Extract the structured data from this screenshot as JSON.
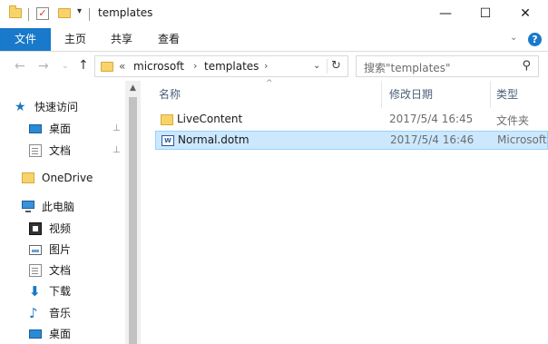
{
  "window": {
    "title": "templates",
    "quick_access_toolbar": {
      "dropdown_glyph": "▾",
      "check_glyph": "✓"
    },
    "controls": {
      "minimize": "—",
      "maximize": "☐",
      "close": "✕"
    }
  },
  "ribbon": {
    "tabs": [
      {
        "label": "文件",
        "active": true
      },
      {
        "label": "主页"
      },
      {
        "label": "共享"
      },
      {
        "label": "查看"
      }
    ],
    "expand_glyph": "⌄",
    "help_glyph": "?"
  },
  "navigation": {
    "back_glyph": "←",
    "forward_glyph": "→",
    "recent_glyph": "⌄",
    "up_glyph": "↑",
    "address": {
      "overflow": "«",
      "breadcrumbs": [
        "microsoft",
        "templates"
      ],
      "separator": "›",
      "dropdown_glyph": "⌄",
      "refresh_glyph": "↻"
    },
    "search": {
      "placeholder": "搜索\"templates\"",
      "icon": "search-icon",
      "icon_glyph": "⚲"
    }
  },
  "sidebar": {
    "scroll_up_glyph": "▲",
    "pin_glyph": "⊥",
    "items": [
      {
        "label": "快速访问",
        "icon": "star-icon",
        "glyph": "★"
      },
      {
        "label": "桌面",
        "icon": "desktop-icon",
        "pinned": true
      },
      {
        "label": "文档",
        "icon": "document-icon",
        "pinned": true
      },
      {
        "label": "OneDrive",
        "icon": "folder-icon"
      },
      {
        "label": "此电脑",
        "icon": "computer-icon"
      },
      {
        "label": "视频",
        "icon": "video-icon"
      },
      {
        "label": "图片",
        "icon": "pictures-icon"
      },
      {
        "label": "文档",
        "icon": "document-icon"
      },
      {
        "label": "下载",
        "icon": "download-icon",
        "glyph": "⬇"
      },
      {
        "label": "音乐",
        "icon": "music-icon",
        "glyph": "♪"
      },
      {
        "label": "桌面",
        "icon": "desktop-icon"
      }
    ]
  },
  "file_list": {
    "columns": [
      "名称",
      "修改日期",
      "类型"
    ],
    "sort_glyph": "^",
    "rows": [
      {
        "name": "LiveContent",
        "modified": "2017/5/4 16:45",
        "type": "文件夹",
        "icon": "folder-icon",
        "selected": false
      },
      {
        "name": "Normal.dotm",
        "modified": "2017/5/4 16:46",
        "type": "Microsoft",
        "icon": "word-template-icon",
        "selected": true
      }
    ]
  },
  "colors": {
    "accent": "#1979ca",
    "selection_bg": "#cce8ff",
    "selection_border": "#99d1ff",
    "folder": "#f7d46a",
    "header_text": "#4c607a"
  }
}
